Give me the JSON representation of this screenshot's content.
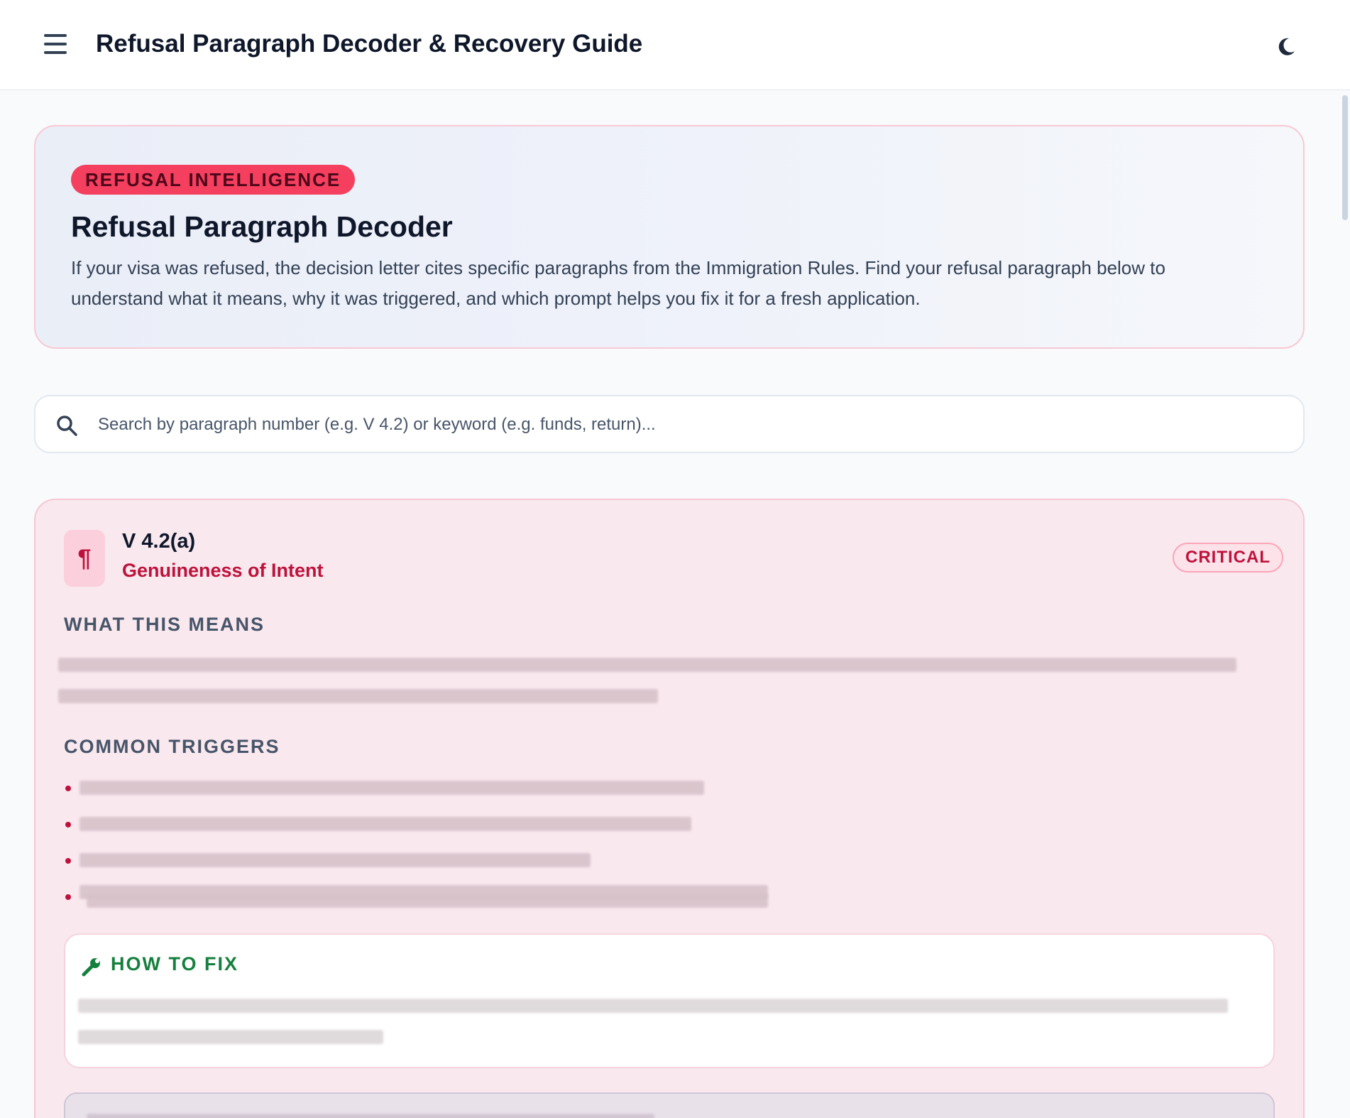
{
  "header": {
    "title": "Refusal Paragraph Decoder & Recovery Guide",
    "menu_icon": "menu-icon",
    "theme_icon": "moon-icon"
  },
  "hero": {
    "badge": "REFUSAL INTELLIGENCE",
    "title": "Refusal Paragraph Decoder",
    "description": "If your visa was refused, the decision letter cites specific paragraphs from the Immigration Rules. Find your refusal paragraph below to understand what it means, why it was triggered, and which prompt helps you fix it for a fresh application."
  },
  "search": {
    "placeholder": "Search by paragraph number (e.g. V 4.2) or keyword (e.g. funds, return)...",
    "value": ""
  },
  "cards": [
    {
      "code": "V 4.2(a)",
      "name": "Genuineness of Intent",
      "severity": "CRITICAL",
      "meaning_heading": "WHAT THIS MEANS",
      "triggers_heading": "COMMON TRIGGERS",
      "fix_heading": "HOW TO FIX"
    }
  ],
  "colors": {
    "accent": "#f43f5e",
    "critical": "#be123c",
    "fix": "#15803d",
    "card_bg": "#f9e8ee"
  }
}
